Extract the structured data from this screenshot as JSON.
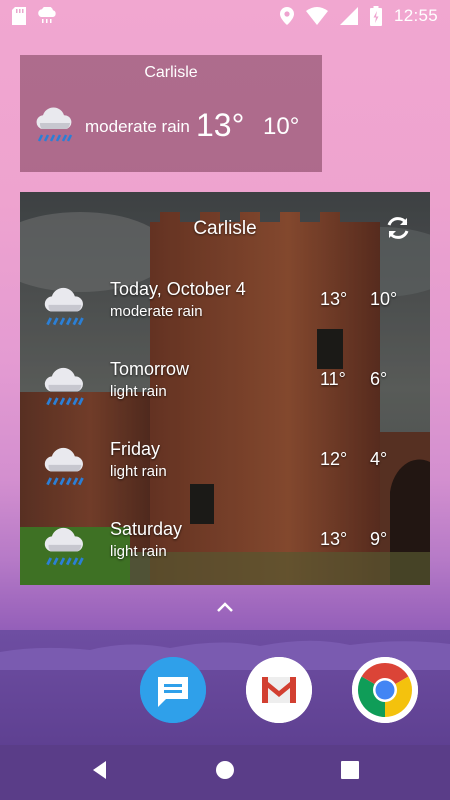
{
  "status_bar": {
    "time": "12:55",
    "left_icons": [
      "sd-card-icon",
      "weather-notification-icon"
    ],
    "right_icons": [
      "location-icon",
      "wifi-icon",
      "battery-icon"
    ]
  },
  "small_widget": {
    "city": "Carlisle",
    "condition": "moderate rain",
    "high": "13°",
    "low": "10°",
    "icon": "rain-cloud-icon"
  },
  "forecast_widget": {
    "city": "Carlisle",
    "refresh_icon": "refresh-icon",
    "days": [
      {
        "day": "Today, October 4",
        "condition": "moderate rain",
        "high": "13°",
        "low": "10°",
        "icon": "rain-cloud-icon"
      },
      {
        "day": "Tomorrow",
        "condition": "light rain",
        "high": "11°",
        "low": "6°",
        "icon": "rain-cloud-icon"
      },
      {
        "day": "Friday",
        "condition": "light rain",
        "high": "12°",
        "low": "4°",
        "icon": "rain-cloud-icon"
      },
      {
        "day": "Saturday",
        "condition": "light rain",
        "high": "13°",
        "low": "9°",
        "icon": "rain-cloud-icon"
      }
    ]
  },
  "dock": {
    "apps": [
      "messages-icon",
      "gmail-icon",
      "chrome-icon"
    ]
  },
  "nav": [
    "back-button",
    "home-button",
    "recents-button"
  ],
  "colors": {
    "small_widget_bg": "#7a3c55",
    "rain_drops": "#2b7fd6",
    "dock_bg": "#6e4ea2"
  }
}
